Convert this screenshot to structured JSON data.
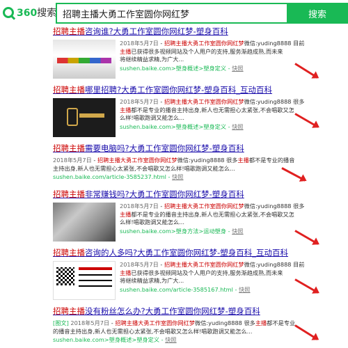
{
  "header": {
    "logo_brand": "360",
    "logo_word": "搜索",
    "query": "招聘主播大勇工作室圆你网红梦",
    "search_button": "搜索"
  },
  "results": [
    {
      "title_hl": "招聘主播",
      "title_rest": "咨询谁?大勇工作室圆你网红梦-塑身百科",
      "date": "2018年5月7日",
      "l1_em": "招聘主播大勇工作室圆你网红梦",
      "l1_rest": "微信:yuding8888 目前",
      "l2_em": "主播",
      "l2_rest": "已获得很多视频网站及个人用户的支持,服务渐趋成熟,而未来",
      "l3": "将继续精益求精,为广大...",
      "url": "sushen.baike.com>塑身概述>塑身定义",
      "snapshot": "快照"
    },
    {
      "title_hl": "招聘主播",
      "title_rest": "哪里招聘?大勇工作室圆你网红梦-塑身百科_互动百科",
      "date": "2018年5月7日",
      "l1_em": "招聘主播大勇工作室圆你网红梦",
      "l1_rest": "微信:yuding8888 很多",
      "l2_em": "主播",
      "l2_rest": "都不是专业的播音主持出身,新人也无需担心太紧张,不会唱歌又怎",
      "l3": "么样!唱歌跑调又能怎么...",
      "url": "sushen.baike.com>塑身概述>塑身定义",
      "snapshot": "快照"
    },
    {
      "title_hl": "招聘主播",
      "title_rest": "需要电脑吗?大勇工作室圆你网红梦-塑身百科",
      "date": "2018年5月7日",
      "l1_em": "招聘主播大勇工作室圆你网红梦",
      "l1_rest": "微信:yuding8888 很多",
      "l1_em2": "主播",
      "l1_tail": "都不是专业的播音",
      "l2": "主持出身,新人也无需担心太紧张,不会唱歌又怎么样!唱歌跑调又能怎么...",
      "url": "sushen.baike.com/article-3585237.html",
      "snapshot": "快照"
    },
    {
      "title_hl": "招聘主播",
      "title_rest": "非常赚钱吗?大勇工作室圆你网红梦-塑身百科",
      "date": "2018年5月7日",
      "l1_em": "招聘主播大勇工作室圆你网红梦",
      "l1_rest": "微信:yuding8888 很多",
      "l2_em": "主播",
      "l2_rest": "都不是专业的播音主持出身,新人也无需担心太紧张,不会唱歌又怎",
      "l3": "么样!唱歌跑调又能怎么...",
      "url": "sushen.baike.com>塑身方法>运动塑身",
      "snapshot": "快照"
    },
    {
      "title_hl": "招聘主播",
      "title_rest": "咨询的人多吗?大勇工作室圆你网红梦-塑身百科_互动百科",
      "date": "2018年5月7日",
      "l1_em": "招聘主播大勇工作室圆你网红梦",
      "l1_rest": "微信:yuding8888 目前",
      "l2_em": "主播",
      "l2_rest": "已获得很多视频网站及个人用户的支持,服务渐趋成熟,而未来",
      "l3": "将继续精益求精,为广大...",
      "url": "sushen.baike.com/article-3585167.html",
      "snapshot": "快照"
    },
    {
      "title_hl": "招聘主播",
      "title_rest": "没有粉丝怎么办?大勇工作室圆你网红梦-塑身百科",
      "tag": "[图文]",
      "date": "2018年5月7日",
      "l1_em": "招聘主播大勇工作室圆你网红梦",
      "l1_rest": "微信:yuding8888 很多",
      "l1_em2": "主播",
      "l1_tail": "都不是专业",
      "l2": "的播音主持出身,新人也无需担心太紧张,不会唱歌又怎么样!唱歌跑调又能怎么...",
      "url": "sushen.baike.com>塑身概述>塑身定义",
      "snapshot": "快照"
    }
  ],
  "colors": {
    "brand_green": "#19b955",
    "title_blue": "#1a0dab",
    "highlight_red": "#cc0000",
    "annotation_arrow": "#e02020"
  }
}
